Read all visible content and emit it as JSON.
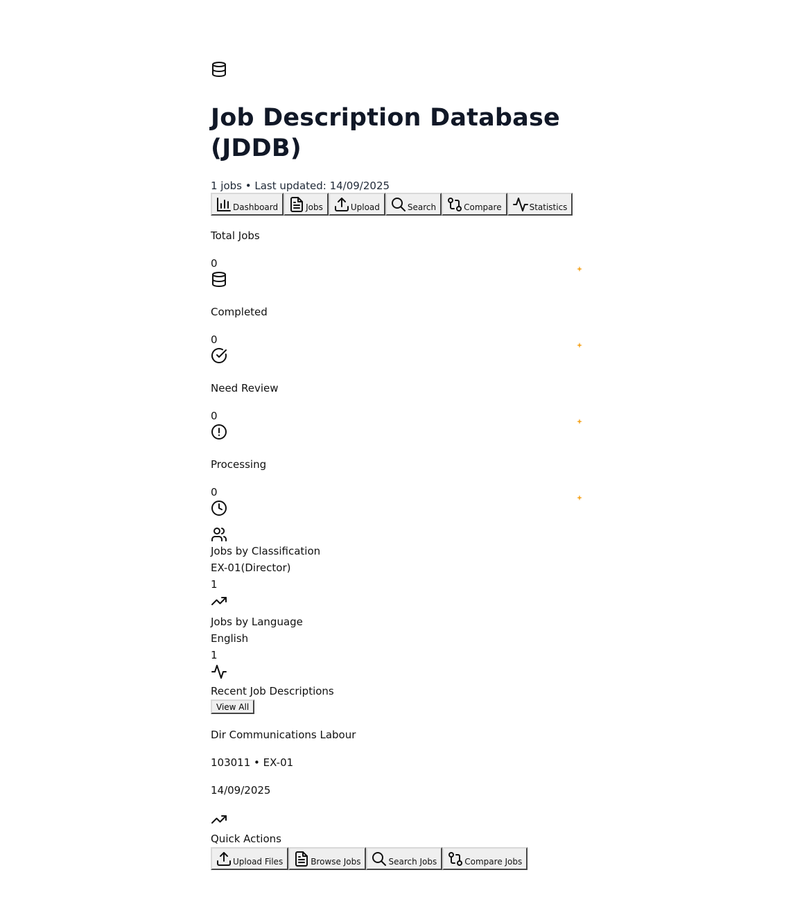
{
  "header": {
    "logo_icon": "database-icon",
    "title": "Job Description Database (JDDB)",
    "subtitle": "1 jobs • Last updated: 14/09/2025"
  },
  "nav": [
    {
      "label": "Dashboard",
      "icon": "bar-chart-icon"
    },
    {
      "label": "Jobs",
      "icon": "file-text-icon"
    },
    {
      "label": "Upload",
      "icon": "upload-icon"
    },
    {
      "label": "Search",
      "icon": "search-icon"
    },
    {
      "label": "Compare",
      "icon": "git-compare-icon"
    },
    {
      "label": "Statistics",
      "icon": "activity-icon"
    }
  ],
  "stats": [
    {
      "title": "Total Jobs",
      "value": "0",
      "icon": "database-icon"
    },
    {
      "title": "Completed",
      "value": "0",
      "icon": "check-circle-icon"
    },
    {
      "title": "Need Review",
      "value": "0",
      "icon": "alert-circle-icon"
    },
    {
      "title": "Processing",
      "value": "0",
      "icon": "clock-icon"
    }
  ],
  "classification": {
    "icon": "users-icon",
    "title": "Jobs by Classification",
    "label": "EX-01(Director)",
    "count": "1",
    "trend_icon": "trending-up-icon"
  },
  "language": {
    "title": "Jobs by Language",
    "label": "English",
    "count": "1",
    "icon": "activity-icon"
  },
  "recent": {
    "title": "Recent Job Descriptions",
    "view_all": "View All",
    "item_title": "Dir Communications Labour",
    "item_meta": "103011 • EX-01",
    "item_date": "14/09/2025",
    "item_icon": "trending-up-icon"
  },
  "quick_actions": {
    "title": "Quick Actions",
    "buttons": [
      {
        "label": "Upload Files",
        "icon": "upload-icon"
      },
      {
        "label": "Browse Jobs",
        "icon": "file-text-icon"
      },
      {
        "label": "Search Jobs",
        "icon": "search-icon"
      },
      {
        "label": "Compare Jobs",
        "icon": "git-compare-icon"
      }
    ]
  },
  "colors": {
    "spark": "#f5a623"
  }
}
